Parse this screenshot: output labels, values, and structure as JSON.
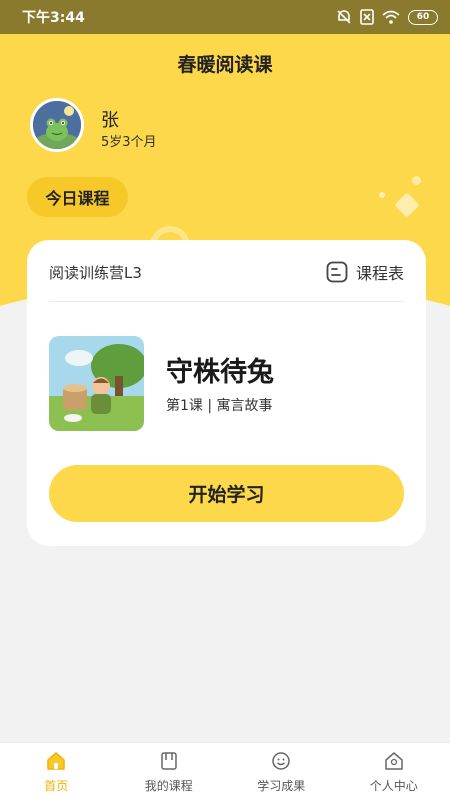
{
  "status_bar": {
    "time": "下午3:44",
    "battery": "60"
  },
  "header": {
    "title": "春暖阅读课"
  },
  "profile": {
    "name": "张",
    "age": "5岁3个月"
  },
  "today_badge": "今日课程",
  "course_card": {
    "camp": "阅读训练营L3",
    "schedule_label": "课程表",
    "lesson_title": "守株待兔",
    "lesson_subtitle": "第1课 | 寓言故事",
    "start_button": "开始学习"
  },
  "bottom_nav": {
    "items": [
      {
        "label": "首页",
        "icon": "home-icon",
        "active": true
      },
      {
        "label": "我的课程",
        "icon": "book-icon",
        "active": false
      },
      {
        "label": "学习成果",
        "icon": "achievement-icon",
        "active": false
      },
      {
        "label": "个人中心",
        "icon": "profile-icon",
        "active": false
      }
    ]
  },
  "colors": {
    "accent": "#fcd84a",
    "badge": "#f6c929",
    "active_nav": "#f0b400",
    "status_bar": "#8a7a2e"
  }
}
